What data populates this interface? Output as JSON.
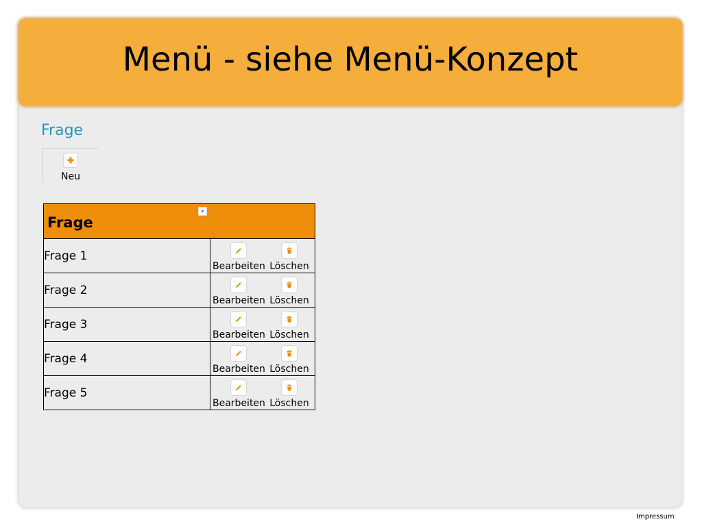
{
  "banner": {
    "title": "Menü - siehe Menü-Konzept"
  },
  "section": {
    "title": "Frage"
  },
  "toolbar": {
    "new_label": "Neu",
    "new_icon": "plus-icon"
  },
  "table": {
    "header": "Frage",
    "sort_icon": "sort-dropdown-icon",
    "rows": [
      {
        "name": "Frage 1",
        "edit_label": "Bearbeiten",
        "delete_label": "Löschen"
      },
      {
        "name": "Frage 2",
        "edit_label": "Bearbeiten",
        "delete_label": "Löschen"
      },
      {
        "name": "Frage 3",
        "edit_label": "Bearbeiten",
        "delete_label": "Löschen"
      },
      {
        "name": "Frage 4",
        "edit_label": "Bearbeiten",
        "delete_label": "Löschen"
      },
      {
        "name": "Frage 5",
        "edit_label": "Bearbeiten",
        "delete_label": "Löschen"
      }
    ]
  },
  "footer": {
    "impressum": "Impressum"
  },
  "colors": {
    "banner": "#f5ad3b",
    "table_header": "#ef8e0a",
    "section_title": "#2a93bd",
    "icon": "#ef8e0a",
    "panel": "#ececec"
  }
}
